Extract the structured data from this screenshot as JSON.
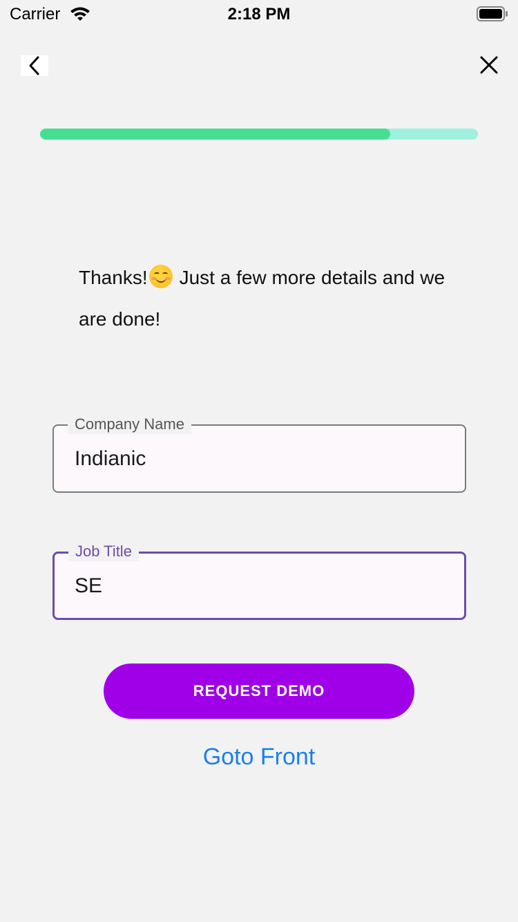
{
  "status_bar": {
    "carrier": "Carrier",
    "time": "2:18 PM"
  },
  "nav": {
    "back_icon": "chevron-left-icon",
    "close_icon": "close-icon"
  },
  "progress": {
    "value_fraction": 0.8,
    "fill_color": "#45df92",
    "track_color": "#9ff0dc"
  },
  "message": {
    "line_start": "Thanks!",
    "emoji": "smiling-face-icon",
    "line_end": "Just a few more details and we are done!"
  },
  "form": {
    "company": {
      "label": "Company Name",
      "value": "Indianic"
    },
    "job_title": {
      "label": "Job Title",
      "value": "SE",
      "accent_color": "#6b4ea8"
    }
  },
  "actions": {
    "request_demo_label": "REQUEST DEMO",
    "request_demo_color": "#a000e8",
    "goto_front_label": "Goto Front",
    "link_color": "#1a7ff0"
  }
}
